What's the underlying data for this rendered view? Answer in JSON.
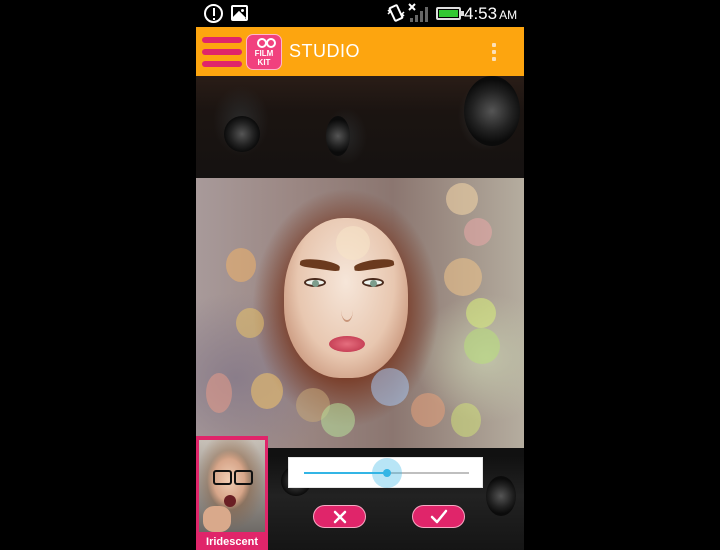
{
  "status_bar": {
    "time": "4:53",
    "ampm": "AM",
    "icons": [
      "alert-icon",
      "image-icon",
      "vibrate-icon",
      "signal-icon",
      "battery-icon"
    ]
  },
  "app_bar": {
    "title": "STUDIO",
    "logo_text_line1": "FILM",
    "logo_text_line2": "KIT",
    "icons": [
      "menu-icon",
      "overflow-menu-icon"
    ],
    "background_color": "#fda50f",
    "accent_color": "#e0256a"
  },
  "filter": {
    "selected_name": "Iridescent"
  },
  "slider": {
    "value_fraction": 0.5,
    "color": "#33b5e5"
  },
  "actions": {
    "cancel_icon": "close-icon",
    "confirm_icon": "check-icon"
  }
}
